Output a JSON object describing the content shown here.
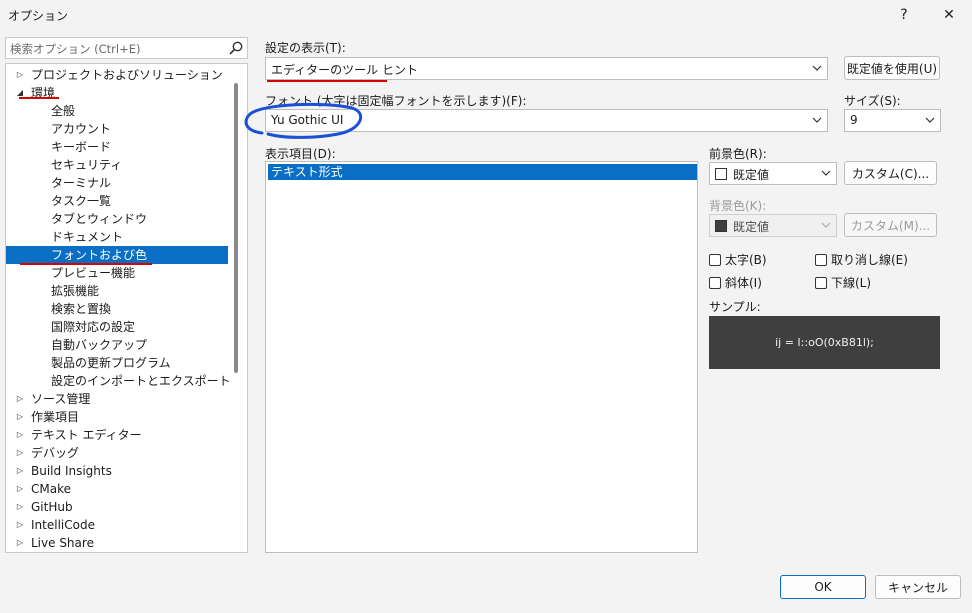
{
  "window": {
    "title": "オプション",
    "help_glyph": "?",
    "close_glyph": "✕"
  },
  "sidebar": {
    "search_placeholder": "検索オプション (Ctrl+E)",
    "items": [
      {
        "label": "プロジェクトおよびソリューション",
        "level": 0,
        "expander": "collapsed"
      },
      {
        "label": "環境",
        "level": 0,
        "expander": "expanded"
      },
      {
        "label": "全般",
        "level": 1
      },
      {
        "label": "アカウント",
        "level": 1
      },
      {
        "label": "キーボード",
        "level": 1
      },
      {
        "label": "セキュリティ",
        "level": 1
      },
      {
        "label": "ターミナル",
        "level": 1
      },
      {
        "label": "タスク一覧",
        "level": 1
      },
      {
        "label": "タブとウィンドウ",
        "level": 1
      },
      {
        "label": "ドキュメント",
        "level": 1
      },
      {
        "label": "フォントおよび色",
        "level": 1,
        "selected": true
      },
      {
        "label": "プレビュー機能",
        "level": 1
      },
      {
        "label": "拡張機能",
        "level": 1
      },
      {
        "label": "検索と置換",
        "level": 1
      },
      {
        "label": "国際対応の設定",
        "level": 1
      },
      {
        "label": "自動バックアップ",
        "level": 1
      },
      {
        "label": "製品の更新プログラム",
        "level": 1
      },
      {
        "label": "設定のインポートとエクスポート",
        "level": 1
      },
      {
        "label": "ソース管理",
        "level": 0,
        "expander": "collapsed"
      },
      {
        "label": "作業項目",
        "level": 0,
        "expander": "collapsed"
      },
      {
        "label": "テキスト エディター",
        "level": 0,
        "expander": "collapsed"
      },
      {
        "label": "デバッグ",
        "level": 0,
        "expander": "collapsed"
      },
      {
        "label": "Build Insights",
        "level": 0,
        "expander": "collapsed"
      },
      {
        "label": "CMake",
        "level": 0,
        "expander": "collapsed"
      },
      {
        "label": "GitHub",
        "level": 0,
        "expander": "collapsed"
      },
      {
        "label": "IntelliCode",
        "level": 0,
        "expander": "collapsed"
      },
      {
        "label": "Live Share",
        "level": 0,
        "expander": "collapsed"
      }
    ]
  },
  "settings": {
    "show_settings_for_label": "設定の表示(T):",
    "show_settings_for_value": "エディターのツール ヒント",
    "use_defaults_button": "既定値を使用(U)",
    "font_label": "フォント (太字は固定幅フォントを示します)(F):",
    "font_value": "Yu Gothic UI",
    "size_label": "サイズ(S):",
    "size_value": "9",
    "display_items_label": "表示項目(D):",
    "display_items": [
      "テキスト形式"
    ],
    "foreground_label": "前景色(R):",
    "foreground_value": "既定値",
    "foreground_custom_button": "カスタム(C)...",
    "background_label": "背景色(K):",
    "background_value": "既定値",
    "background_custom_button": "カスタム(M)...",
    "bold_label": "太字(B)",
    "strikethrough_label": "取り消し線(E)",
    "italic_label": "斜体(I)",
    "underline_label": "下線(L)",
    "sample_label": "サンプル:",
    "sample_text": "ij = I::oO(0xB81l);"
  },
  "footer": {
    "ok_label": "OK",
    "cancel_label": "キャンセル"
  },
  "colors": {
    "accent": "#0a6fc4",
    "annotation_red": "#d60000",
    "annotation_blue": "#1a4fd6",
    "sample_bg": "#3f3f3f"
  }
}
